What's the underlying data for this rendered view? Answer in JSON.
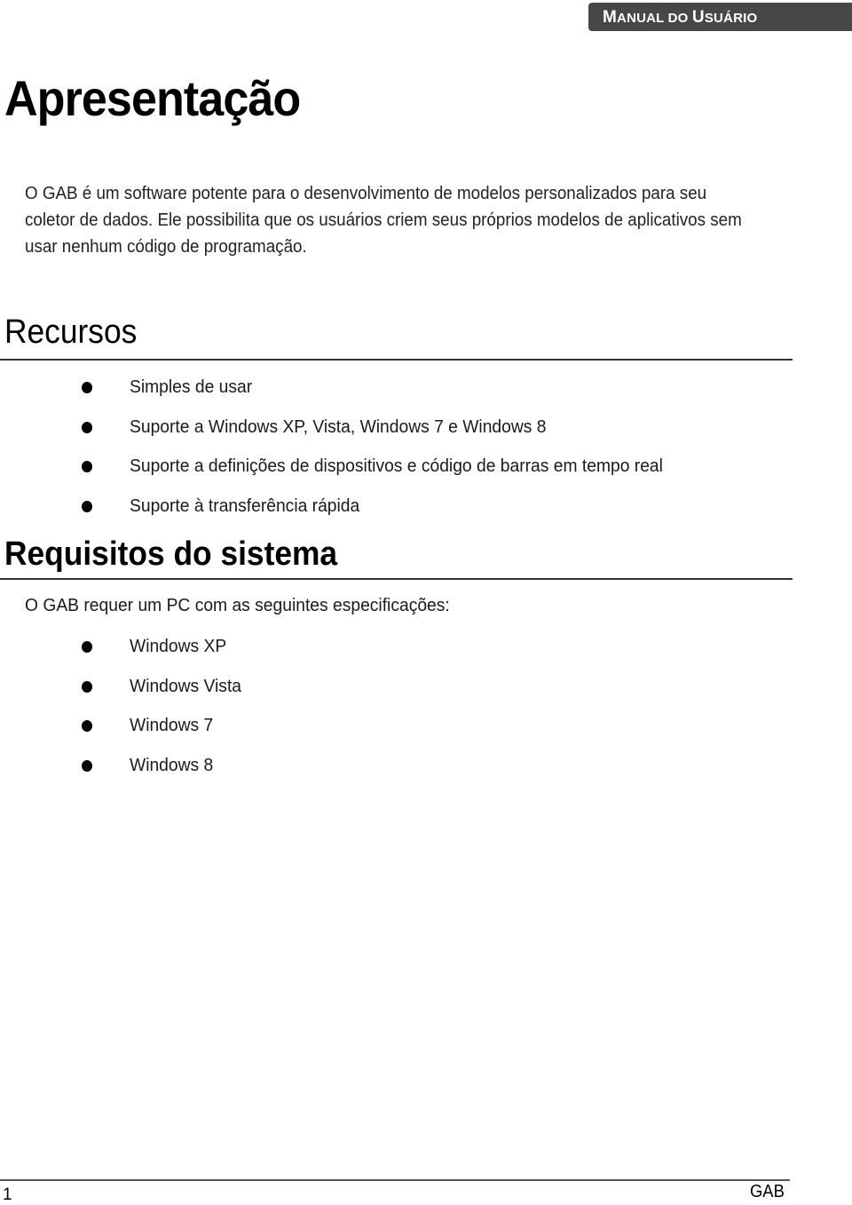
{
  "header": {
    "label_parts": [
      "M",
      "ANUAL DO ",
      "U",
      "SUÁRIO"
    ],
    "label": "Manual do Usuário"
  },
  "title": "Apresentação",
  "intro_paragraph": "O GAB é um software potente para o desenvolvimento de modelos personalizados para seu coletor de dados. Ele possibilita que os usuários criem seus próprios modelos de aplicativos sem usar nenhum código de programação.",
  "resources": {
    "heading": "Recursos",
    "items": [
      "Simples de usar",
      "Suporte a Windows XP, Vista, Windows 7 e Windows 8",
      "Suporte a definições de dispositivos e código de barras em tempo real",
      "Suporte à transferência rápida"
    ]
  },
  "requirements": {
    "heading": "Requisitos do sistema",
    "intro": "O GAB requer um PC com as seguintes especificações:",
    "items": [
      "Windows XP",
      "Windows Vista",
      "Windows 7",
      "Windows 8"
    ]
  },
  "footer": {
    "page_number": "1",
    "brand": "GAB"
  }
}
